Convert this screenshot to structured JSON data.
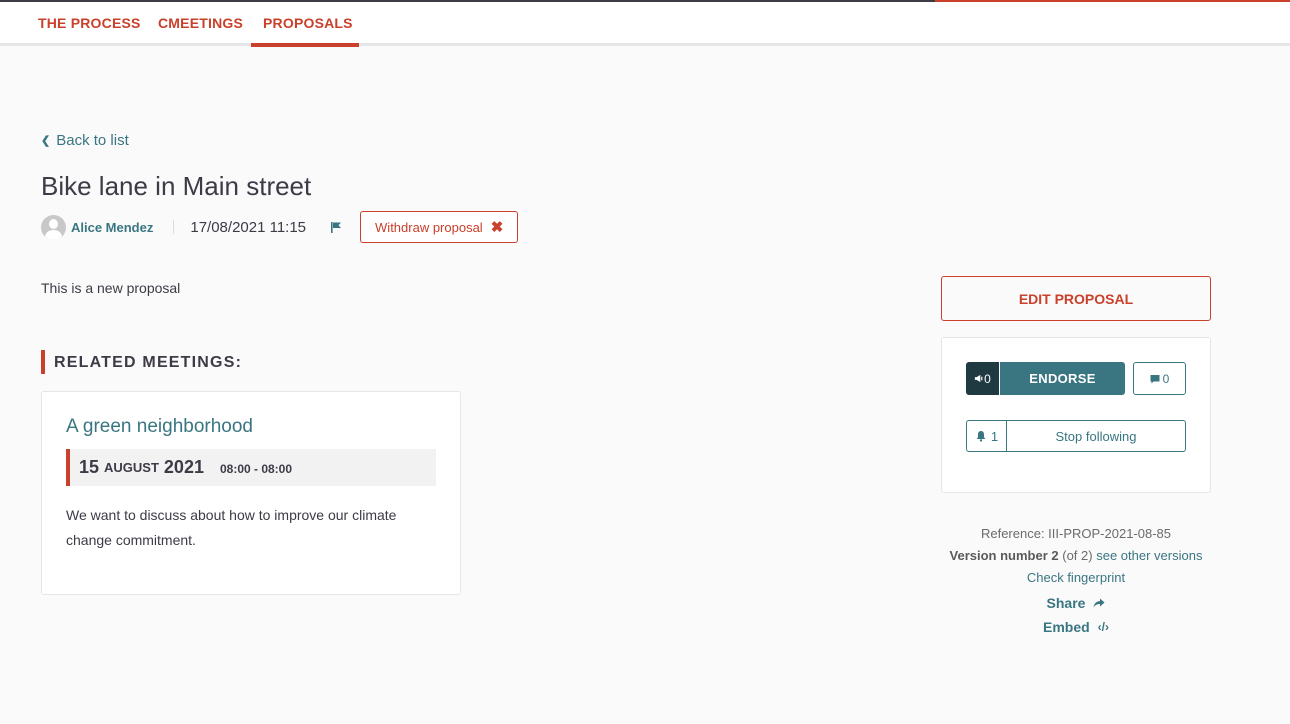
{
  "nav": {
    "items": [
      {
        "label": "THE PROCESS",
        "active": false
      },
      {
        "label": "CMEETINGS",
        "active": false
      },
      {
        "label": "PROPOSALS",
        "active": true
      }
    ]
  },
  "back": {
    "label": "Back to list",
    "icon": "chevron-left-icon"
  },
  "proposal": {
    "title": "Bike lane in Main street",
    "author": "Alice Mendez",
    "date": "17/08/2021 11:15",
    "flag_icon": "flag-icon",
    "withdraw_label": "Withdraw proposal",
    "body": "This is a new proposal"
  },
  "related_meetings": {
    "heading": "RELATED MEETINGS:",
    "items": [
      {
        "title": "A green neighborhood",
        "day": "15",
        "month": "August",
        "year": "2021",
        "time": "08:00 - 08:00",
        "description": "We want to discuss about how to improve our climate change commitment."
      }
    ]
  },
  "sidebar": {
    "edit_label": "EDIT PROPOSAL",
    "endorse": {
      "count": "0",
      "label": "ENDORSE",
      "icon": "megaphone-icon"
    },
    "comments": {
      "count": "0",
      "icon": "comment-icon"
    },
    "follow": {
      "count": "1",
      "label": "Stop following",
      "icon": "bell-icon"
    },
    "reference": "Reference: III-PROP-2021-08-85",
    "version": {
      "prefix": "Version number 2",
      "of": "(of 2)",
      "link": "see other versions"
    },
    "fingerprint": "Check fingerprint",
    "share": "Share",
    "embed": "Embed"
  },
  "colors": {
    "accent": "#c9402b",
    "primary": "#3a7682",
    "dark": "#1f3a41",
    "text": "#3e3a46"
  }
}
